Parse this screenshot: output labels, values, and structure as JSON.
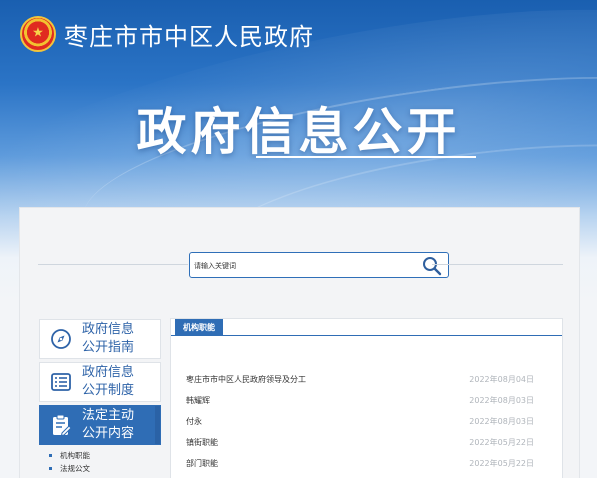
{
  "header": {
    "site_name": "枣庄市市中区人民政府",
    "hero_title": "政府信息公开"
  },
  "search": {
    "placeholder": "请输入关键词"
  },
  "sidebar": {
    "items": [
      {
        "label": "政府信息\n公开指南",
        "icon": "compass-icon",
        "active": false
      },
      {
        "label": "政府信息\n公开制度",
        "icon": "document-list-icon",
        "active": false
      },
      {
        "label": "法定主动\n公开内容",
        "icon": "clipboard-edit-icon",
        "active": true
      }
    ],
    "sub_items": [
      "机构职能",
      "法规公文"
    ]
  },
  "content": {
    "tab_label": "机构职能",
    "articles": [
      {
        "title": "枣庄市市中区人民政府领导及分工",
        "date": "2022年08月04日"
      },
      {
        "title": "韩耀辉",
        "date": "2022年08月03日"
      },
      {
        "title": "付永",
        "date": "2022年08月03日"
      },
      {
        "title": "镇街职能",
        "date": "2022年05月22日"
      },
      {
        "title": "部门职能",
        "date": "2022年05月22日"
      }
    ]
  },
  "colors": {
    "primary": "#2f6db5",
    "link_text": "#2e63a8",
    "date_text": "#b0b5bb"
  }
}
